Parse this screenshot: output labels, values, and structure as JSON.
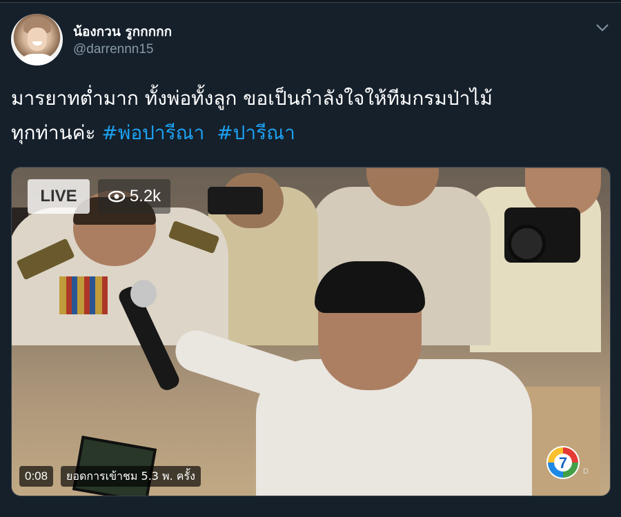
{
  "user": {
    "display_name": "น้องกวน รูกกกกก",
    "handle": "@darrennn15"
  },
  "tweet": {
    "text_line1": "มารยาทต่ำมาก ทั้งพ่อทั้งลูก ขอเป็นกำลังใจให้ทีมกรมป่าไม้",
    "text_line2_prefix": "ทุกท่านค่ะ ",
    "hashtags": [
      "#พ่อปารีณา",
      "#ปารีณา"
    ]
  },
  "video": {
    "live_label": "LIVE",
    "viewers": "5.2k",
    "duration": "0:08",
    "views_text": "ยอดการเข้าชม 5.3 พ. ครั้ง",
    "watermark": "7",
    "watermark_suffix": "D"
  },
  "icons": {
    "caret": "chevron-down-icon",
    "eye": "eye-icon",
    "logo": "channel7-logo"
  },
  "colors": {
    "background": "#15202b",
    "hashtag": "#1da1f2",
    "handle": "#8899a6"
  }
}
